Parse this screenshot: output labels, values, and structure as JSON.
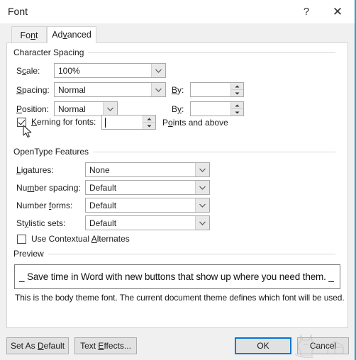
{
  "window": {
    "title": "Font",
    "help_glyph": "?",
    "close_glyph": "✕"
  },
  "tabs": [
    {
      "label_before": "Fo",
      "label_accel": "n",
      "label_after": "t",
      "name": "Font",
      "active": false
    },
    {
      "label_before": "Ad",
      "label_accel": "v",
      "label_after": "anced",
      "name": "Advanced",
      "active": true
    }
  ],
  "character_spacing": {
    "group_label": "Character Spacing",
    "scale": {
      "label_before": "S",
      "label_accel": "c",
      "label_after": "ale:",
      "value": "100%"
    },
    "spacing": {
      "label_before": "",
      "label_accel": "S",
      "label_after": "pacing:",
      "value": "Normal",
      "by_label_before": "",
      "by_label_accel": "B",
      "by_label_after": "y:",
      "by_value": ""
    },
    "position": {
      "label_before": "",
      "label_accel": "P",
      "label_after": "osition:",
      "value": "Normal",
      "by_label_before": "B",
      "by_label_accel": "y",
      "by_label_after": ":",
      "by_value": ""
    },
    "kerning": {
      "checked": true,
      "label_before": "",
      "label_accel": "K",
      "label_after": "erning for fonts:",
      "value": "",
      "suffix_before": "P",
      "suffix_accel": "o",
      "suffix_after": "ints and above"
    }
  },
  "opentype_features": {
    "group_label": "OpenType Features",
    "rows": [
      {
        "label_before": "",
        "label_accel": "L",
        "label_after": "igatures:",
        "value": "None"
      },
      {
        "label_before": "Nu",
        "label_accel": "m",
        "label_after": "ber spacing:",
        "value": "Default"
      },
      {
        "label_before": "Number ",
        "label_accel": "f",
        "label_after": "orms:",
        "value": "Default"
      },
      {
        "label_before": "St",
        "label_accel": "y",
        "label_after": "listic sets:",
        "value": "Default"
      }
    ],
    "contextual_alternates": {
      "checked": false,
      "label_before": "Use Contextual ",
      "label_accel": "A",
      "label_after": "lternates"
    }
  },
  "preview": {
    "group_label": "Preview",
    "sample_text": "_ Save time in Word with new buttons that show up where you need them. _",
    "note": "This is the body theme font. The current document theme defines which font will be used."
  },
  "footer": {
    "set_as_default": {
      "before": "Set As ",
      "accel": "D",
      "after": "efault"
    },
    "text_effects": {
      "before": "Text ",
      "accel": "E",
      "after": "ffects..."
    },
    "ok": "OK",
    "cancel": "Cancel"
  },
  "colors": {
    "accent_focus": "#0078d7",
    "dialog_edge": "#2aa0c8",
    "panel_bg": "#ffffff",
    "chrome_bg": "#f0f0f0",
    "button_bg": "#e1e1e1"
  }
}
